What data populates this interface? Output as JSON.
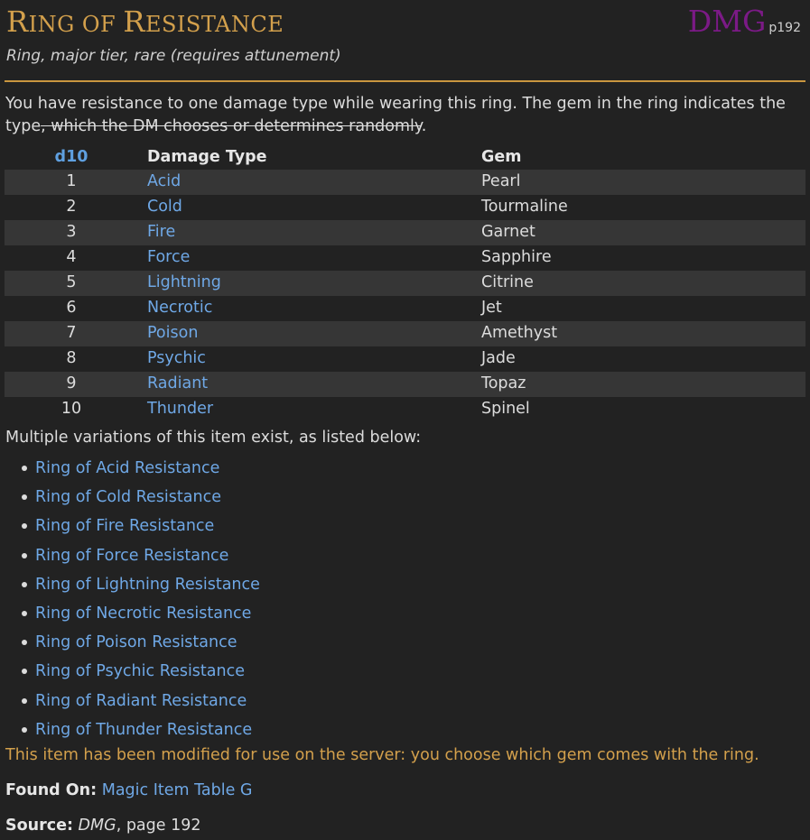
{
  "item": {
    "title_parts": [
      {
        "text": "R",
        "small": false
      },
      {
        "text": "ING OF ",
        "small": true
      },
      {
        "text": "R",
        "small": false
      },
      {
        "text": "ESISTANCE",
        "small": true
      }
    ],
    "source_abbr": "DMG",
    "source_page": "p192",
    "subtitle": "Ring, major tier, rare (requires attunement)"
  },
  "description": {
    "text_main": "You have resistance to one damage type while wearing this ring. The gem in the ring indicates the type",
    "text_struck": ", which the DM chooses or determines randomly",
    "text_end": "."
  },
  "table": {
    "headers": {
      "d10": "d10",
      "type": "Damage Type",
      "gem": "Gem"
    },
    "rows": [
      {
        "roll": "1",
        "type": "Acid",
        "gem": "Pearl"
      },
      {
        "roll": "2",
        "type": "Cold",
        "gem": "Tourmaline"
      },
      {
        "roll": "3",
        "type": "Fire",
        "gem": "Garnet"
      },
      {
        "roll": "4",
        "type": "Force",
        "gem": "Sapphire"
      },
      {
        "roll": "5",
        "type": "Lightning",
        "gem": "Citrine"
      },
      {
        "roll": "6",
        "type": "Necrotic",
        "gem": "Jet"
      },
      {
        "roll": "7",
        "type": "Poison",
        "gem": "Amethyst"
      },
      {
        "roll": "8",
        "type": "Psychic",
        "gem": "Jade"
      },
      {
        "roll": "9",
        "type": "Radiant",
        "gem": "Topaz"
      },
      {
        "roll": "10",
        "type": "Thunder",
        "gem": "Spinel"
      }
    ]
  },
  "variations": {
    "intro": "Multiple variations of this item exist, as listed below:",
    "items": [
      "Ring of Acid Resistance",
      "Ring of Cold Resistance",
      "Ring of Fire Resistance",
      "Ring of Force Resistance",
      "Ring of Lightning Resistance",
      "Ring of Necrotic Resistance",
      "Ring of Poison Resistance",
      "Ring of Psychic Resistance",
      "Ring of Radiant Resistance",
      "Ring of Thunder Resistance"
    ]
  },
  "note": "This item has been modified for use on the server: you choose which gem comes with the ring.",
  "found_on": {
    "label": "Found On:",
    "link": "Magic Item Table G"
  },
  "source": {
    "label": "Source:",
    "book": "DMG",
    "rest": ", page 192"
  },
  "colors": {
    "background": "#222222",
    "title": "#d3a04c",
    "source_badge": "#7b1a86",
    "link": "#6fa8e6",
    "note": "#d3a04c",
    "stripe": "#363636",
    "rule": "#c9963f"
  }
}
